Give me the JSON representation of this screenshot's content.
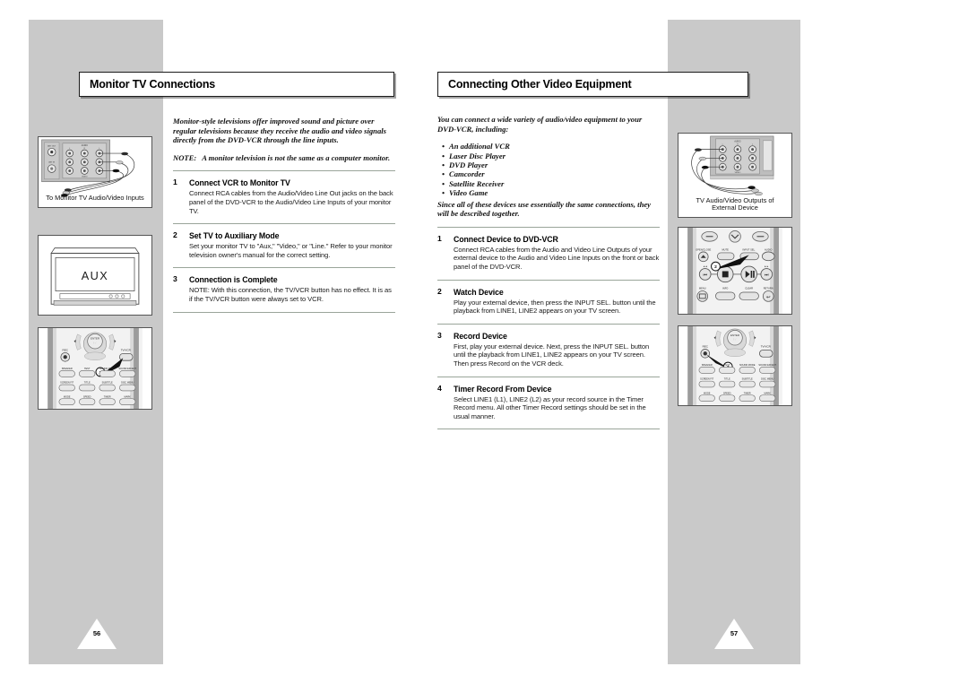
{
  "document": {
    "type": "manual-spread",
    "background_color": "#ffffff",
    "band_color": "#c9c9c9"
  },
  "left_page": {
    "page_number": "56",
    "title": "Monitor TV Connections",
    "intro": "Monitor-style televisions offer improved sound and picture over regular televisions because they receive the audio and video signals directly from the DVD-VCR through the line inputs.",
    "note_label": "NOTE:",
    "note_text": "A monitor television is not the same as a computer monitor.",
    "steps": [
      {
        "number": "1",
        "heading": "Connect VCR to Monitor TV",
        "text": "Connect RCA cables from the Audio/Video Line Out jacks on the back panel of the DVD-VCR to the Audio/Video Line Inputs of your monitor TV."
      },
      {
        "number": "2",
        "heading": "Set TV to Auxiliary Mode",
        "text": "Set your monitor TV to \"Aux,\" \"Video,\" or \"Line.\" Refer to your monitor television owner's manual for the correct setting."
      },
      {
        "number": "3",
        "heading": "Connection is Complete",
        "text": "NOTE: With this connection, the TV/VCR button has no effect. It is as if the TV/VCR button were always set to VCR."
      }
    ],
    "figures": [
      {
        "name": "jack-panel-figure",
        "caption": "To Monitor TV Audio/Video Inputs",
        "panel_labels": {
          "audio": "AUDIO",
          "video": "VIDEO",
          "left": "L",
          "right": "R",
          "antenna_in": "ANT IN",
          "antenna_out": "ANT OUT"
        }
      },
      {
        "name": "aux-tv-figure",
        "screen_text": "AUX"
      },
      {
        "name": "remote-tvvcr-figure",
        "callout": "3",
        "buttons": [
          "ENTER",
          "REC",
          "TV/VCR",
          "SPEAKER",
          "TEST",
          "SOUND MODE",
          "SOUND EFFECT",
          "SCREEN FIT",
          "TITLE",
          "SUBTITLE",
          "DISC MENU",
          "MODE",
          "SPEED",
          "TIMER",
          "MARK"
        ]
      }
    ]
  },
  "right_page": {
    "page_number": "57",
    "title": "Connecting Other Video Equipment",
    "intro": "You can connect a wide variety of audio/video equipment to your DVD-VCR, including:",
    "bullets": [
      "An additional VCR",
      "Laser Disc Player",
      "DVD Player",
      "Camcorder",
      "Satellite Receiver",
      "Video Game"
    ],
    "intro2": "Since all of these devices use essentially the same connections, they will be described together.",
    "steps": [
      {
        "number": "1",
        "heading": "Connect Device to DVD-VCR",
        "text": "Connect RCA cables from the Audio and Video Line Outputs of your external device to the Audio and Video Line Inputs on the front or back panel of the DVD-VCR."
      },
      {
        "number": "2",
        "heading": "Watch Device",
        "text": "Play your external device, then press the INPUT SEL. button until the playback from LINE1, LINE2 appears on your TV screen."
      },
      {
        "number": "3",
        "heading": "Record Device",
        "text": "First, play your external device. Next, press the INPUT SEL. button until the playback from LINE1, LINE2 appears on your TV screen. Then press Record on the VCR deck."
      },
      {
        "number": "4",
        "heading": "Timer Record From Device",
        "text": "Select LINE1 (L1), LINE2 (L2) as your record source in the Timer Record menu. All other Timer Record settings should be set in the usual manner."
      }
    ],
    "figures": [
      {
        "name": "external-device-jacks-figure",
        "caption_line1": "TV Audio/Video Outputs of",
        "caption_line2": "External Device",
        "panel_labels": {
          "audio": "AUDIO",
          "video": "VIDEO",
          "left": "L",
          "right": "R"
        }
      },
      {
        "name": "remote-input-sel-figure",
        "callout": "2",
        "buttons": [
          "OPEN/CLOSE",
          "MUTE",
          "INPUT SEL.",
          "AUDIO",
          "MENU",
          "INFO",
          "CLEAR",
          "RETURN"
        ]
      },
      {
        "name": "remote-rec-figure",
        "callout": "3",
        "buttons": [
          "ENTER",
          "REC",
          "TV/VCR",
          "SPEAKER",
          "TEST",
          "SOUND MODE",
          "SOUND EFFECT",
          "SCREEN FIT",
          "TITLE",
          "SUBTITLE",
          "DISC MENU",
          "MODE",
          "SPEED",
          "TIMER",
          "MARK"
        ]
      }
    ]
  }
}
